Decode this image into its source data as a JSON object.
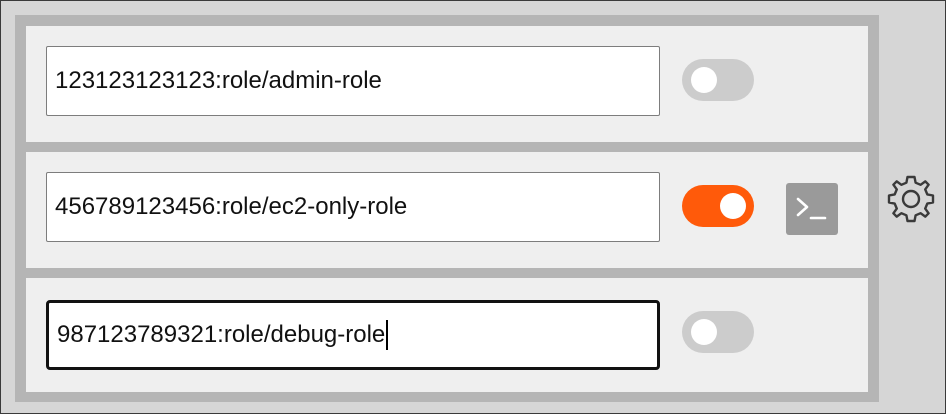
{
  "roles": [
    {
      "arn": "123123123123:role/admin-role",
      "enabled": false,
      "focused": false
    },
    {
      "arn": "456789123456:role/ec2-only-role",
      "enabled": true,
      "focused": false
    },
    {
      "arn": "987123789321:role/debug-role",
      "enabled": false,
      "focused": true
    }
  ],
  "colors": {
    "toggle_on": "#ff5a0a",
    "toggle_off": "#cccccc",
    "terminal_button": "#9a9a9a"
  },
  "icons": {
    "terminal": "terminal-icon",
    "settings": "gear-icon"
  }
}
